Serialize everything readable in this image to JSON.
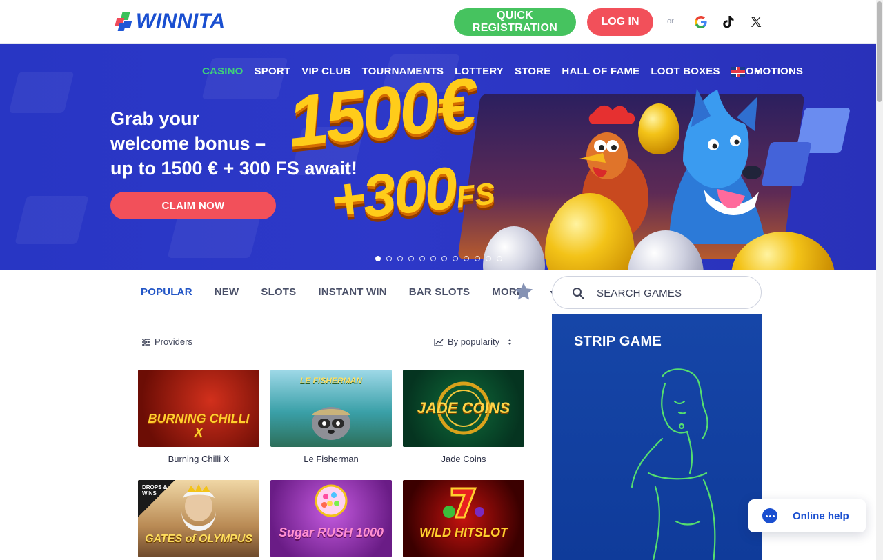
{
  "header": {
    "logo_text": "WINNITA",
    "register_label": "QUICK REGISTRATION",
    "login_label": "LOG IN",
    "or_label": "or",
    "social_icons": [
      "google-icon",
      "tiktok-icon",
      "x-icon"
    ]
  },
  "nav": {
    "items": [
      "CASINO",
      "SPORT",
      "VIP CLUB",
      "TOURNAMENTS",
      "LOTTERY",
      "STORE",
      "HALL OF FAME",
      "LOOT BOXES",
      "PROMOTIONS"
    ],
    "active": "CASINO",
    "language_flag": "uk-flag-icon"
  },
  "hero": {
    "title_lines": [
      "Grab your",
      "welcome bonus –",
      "up to 1500 € + 300 FS await!"
    ],
    "cta_label": "CLAIM NOW",
    "bonus_amount": "1500€",
    "bonus_spins": "+300",
    "bonus_spins_suffix": "FS",
    "slide_count": 12,
    "active_slide": 0
  },
  "tabs": {
    "items": [
      "POPULAR",
      "NEW",
      "SLOTS",
      "INSTANT WIN",
      "BAR SLOTS",
      "MORE"
    ],
    "active": "POPULAR"
  },
  "search": {
    "placeholder": "SEARCH GAMES"
  },
  "filters": {
    "providers_label": "Providers",
    "sort_label": "By popularity"
  },
  "games": [
    {
      "name": "Burning Chilli X",
      "art_text": "BURNING CHILLI X"
    },
    {
      "name": "Le Fisherman",
      "art_text": "LE FISHERMAN"
    },
    {
      "name": "Jade Coins",
      "art_text": "JADE COINS"
    },
    {
      "name": "Gates of Olympus",
      "art_text": "GATES of OLYMPUS",
      "badge": "DROPS & WINS"
    },
    {
      "name": "Sugar Rush 1000",
      "art_text": "Sugar RUSH 1000"
    },
    {
      "name": "Wild Hitslot",
      "art_text": "WILD HITSLOT"
    }
  ],
  "promo": {
    "title": "STRIP GAME"
  },
  "chat": {
    "label": "Online help"
  },
  "colors": {
    "brand_blue": "#1a4fd0",
    "register_green": "#46c35f",
    "login_red": "#f2505a",
    "nav_active": "#3fd17a",
    "tab_active": "#2356c6"
  }
}
